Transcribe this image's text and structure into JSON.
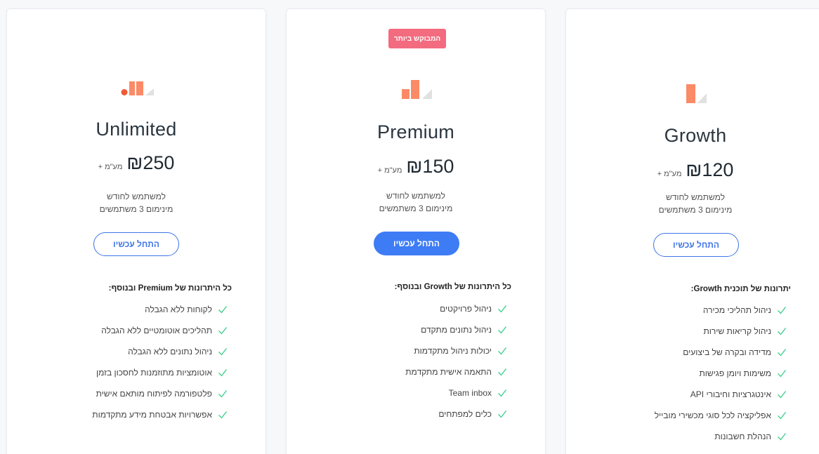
{
  "colors": {
    "accent": "#3d7cf5",
    "badge": "#f36b7f",
    "logo_orange": "#fb8a66",
    "logo_dot": "#f05a37",
    "logo_gray": "#e1e1e1",
    "check": "#3fcf8e"
  },
  "plans": [
    {
      "id": "unlimited",
      "logo_icon": "bar-chart-logo-icon",
      "title": "Unlimited",
      "price": "₪250",
      "vat": "+ מע\"מ",
      "per_user": "למשתמש לחודש",
      "minimum": "מינימום 3 משתמשים",
      "cta": "התחל עכשיו",
      "features_heading": "כל היתרונות של Premium ובנוסף:",
      "features": [
        "לקוחות ללא הגבלה",
        "תהליכים אוטומטיים ללא הגבלה",
        "ניהול נתונים ללא הגבלה",
        "אוטומציות מתוזמנות לחסכון בזמן",
        "פלטפורמה לפיתוח מותאם אישית",
        "אפשרויות אבטחת מידע מתקדמות"
      ]
    },
    {
      "id": "premium",
      "badge": "המבוקש ביותר",
      "logo_icon": "bar-chart-logo-icon",
      "title": "Premium",
      "price": "₪150",
      "vat": "+ מע\"מ",
      "per_user": "למשתמש לחודש",
      "minimum": "מינימום 3 משתמשים",
      "cta": "התחל עכשיו",
      "features_heading": "כל היתרונות של Growth ובנוסף:",
      "features": [
        "ניהול פרויקטים",
        "ניהול נתונים מתקדם",
        "יכולות ניהול מתקדמות",
        "התאמה אישית מתקדמת",
        "Team inbox",
        "כלים למפתחים"
      ]
    },
    {
      "id": "growth",
      "logo_icon": "bar-chart-logo-icon",
      "title": "Growth",
      "price": "₪120",
      "vat": "+ מע\"מ",
      "per_user": "למשתמש לחודש",
      "minimum": "מינימום 3 משתמשים",
      "cta": "התחל עכשיו",
      "features_heading": "יתרונות של תוכנית Growth:",
      "features": [
        "ניהול תהליכי מכירה",
        "ניהול קריאות שירות",
        "מדידה ובקרה של ביצועים",
        "משימות ויומן פגישות",
        "אינטגרציות וחיבורי API",
        "אפליקציה לכל סוגי מכשירי מובייל",
        "הנהלת חשבונות"
      ]
    }
  ]
}
